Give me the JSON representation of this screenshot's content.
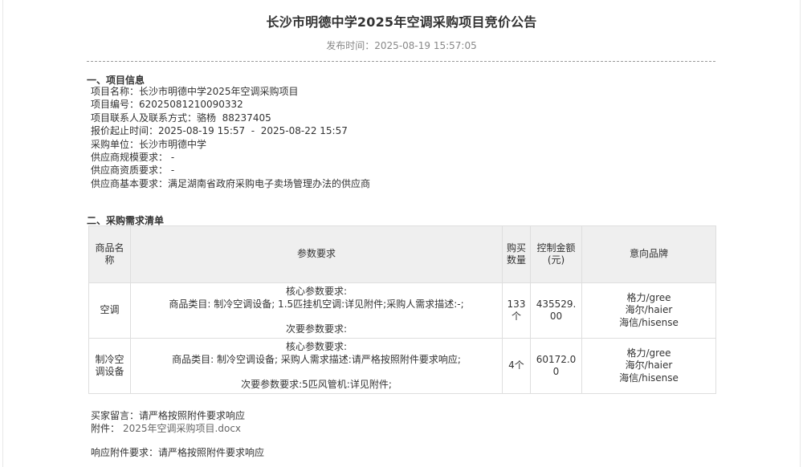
{
  "title": "长沙市明德中学2025年空调采购项目竞价公告",
  "publish": {
    "label": "发布时间：",
    "value": "2025-08-19 15:57:05"
  },
  "section1": {
    "heading": "一、项目信息",
    "rows": [
      {
        "label": "项目名称：",
        "value": "长沙市明德中学2025年空调采购项目"
      },
      {
        "label": "项目编号：",
        "value": "62025081210090332"
      },
      {
        "label": "项目联系人及联系方式：",
        "value": "骆杨  88237405"
      },
      {
        "label": "报价起止时间：",
        "value": "2025-08-19 15:57  -  2025-08-22 15:57"
      },
      {
        "label": "采购单位：",
        "value": "长沙市明德中学"
      },
      {
        "label": "供应商规模要求：",
        "value": " -"
      },
      {
        "label": "供应商资质要求：",
        "value": " -"
      },
      {
        "label": "供应商基本要求：",
        "value": "满足湖南省政府采购电子卖场管理办法的供应商"
      }
    ]
  },
  "section2": {
    "heading": "二、采购需求清单",
    "headers": {
      "name": "商品名称",
      "params": "参数要求",
      "qty": "购买数量",
      "amount": "控制金额(元)",
      "brand": "意向品牌"
    },
    "rows": [
      {
        "name": "空调",
        "core_title": "核心参数要求:",
        "core_detail": "商品类目: 制冷空调设备; 1.5匹挂机空调:详见附件;采购人需求描述:-;",
        "sub_title": "次要参数要求:",
        "qty": "133个",
        "amount": "435529.00",
        "brands": [
          "格力/gree",
          "海尔/haier",
          "海信/hisense"
        ]
      },
      {
        "name": "制冷空调设备",
        "core_title": "核心参数要求:",
        "core_detail": "商品类目: 制冷空调设备; 采购人需求描述:请严格按照附件要求响应;",
        "sub_title": "次要参数要求:5匹风管机:详见附件;",
        "qty": "4个",
        "amount": "60172.00",
        "brands": [
          "格力/gree",
          "海尔/haier",
          "海信/hisense"
        ]
      }
    ]
  },
  "footer": {
    "message_label": "买家留言：",
    "message_value": "请严格按照附件要求响应",
    "attachment_label": "附件：",
    "attachment_value": "2025年空调采购项目.docx",
    "response_label": "响应附件要求：",
    "response_value": "请严格按照附件要求响应"
  }
}
